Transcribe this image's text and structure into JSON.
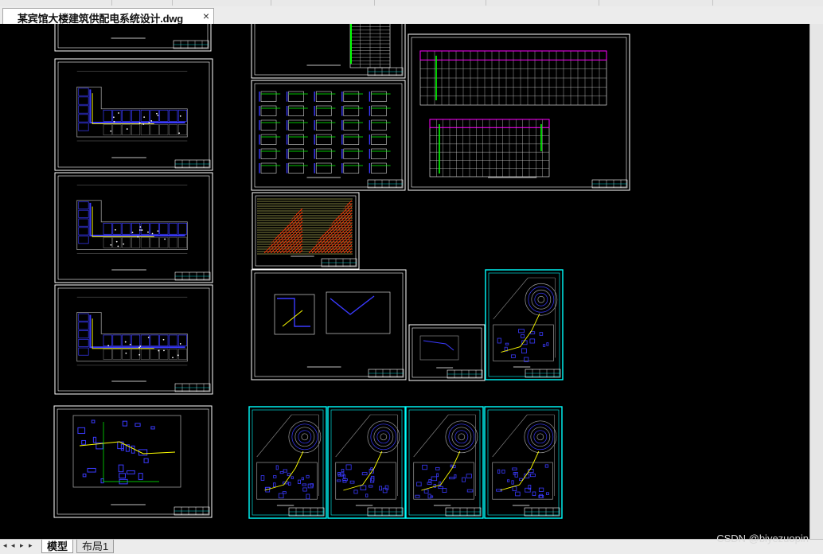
{
  "tab": {
    "file_name": "某宾馆大楼建筑供配电系统设计.dwg",
    "close_glyph": "×"
  },
  "layout_tabs": [
    {
      "label": "模型",
      "active": true
    },
    {
      "label": "布局1",
      "active": false
    }
  ],
  "watermark": "CSDN @biyezuopin",
  "colors": {
    "canvas": "#000000",
    "sheet_border": "#ffffff",
    "selected_border": "#00ffff",
    "wire": "#ffff00",
    "wall": "#3a3aff",
    "label": "#00ff00",
    "hatch": "#ff2a00"
  }
}
